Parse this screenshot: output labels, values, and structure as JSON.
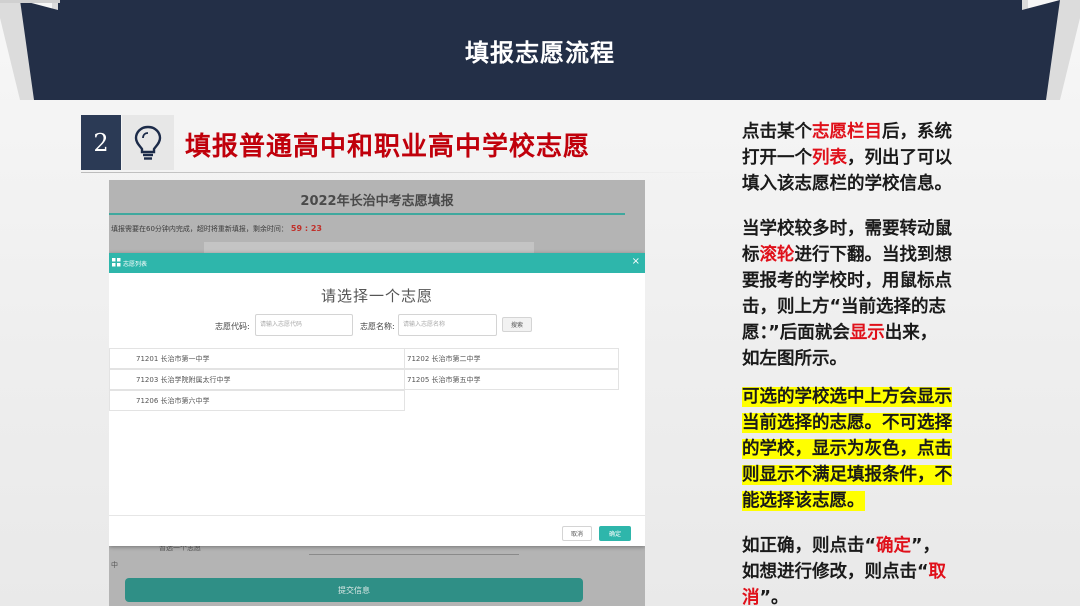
{
  "header": {
    "title": "填报志愿流程"
  },
  "section": {
    "number": "2",
    "icon": "lightbulb-icon",
    "title": "填报普通高中和职业高中学校志愿"
  },
  "screenshot": {
    "page_title": "2022年长治中考志愿填报",
    "timer_text": "填报需要在60分钟内完成，超时将重新填报，剩余时间：",
    "timer_value": "59 : 23",
    "modal": {
      "header_label": "志愿列表",
      "close_symbol": "×",
      "prompt": "请选择一个志愿",
      "code_label": "志愿代码:",
      "code_placeholder": "请输入志愿代码",
      "name_label": "志愿名称:",
      "name_placeholder": "请输入志愿名称",
      "search_label": "搜索",
      "schools": [
        "71201  长治市第一中学",
        "71202  长治市第二中学",
        "71203  长治学院附属太行中学",
        "71205  长治市第五中学",
        "71206  长治市第六中学"
      ],
      "cancel_label": "取消",
      "ok_label": "确定"
    },
    "behind_text": "暂选一个志愿",
    "behind_mark": "中",
    "submit_label": "提交信息"
  },
  "right_text": {
    "p1": {
      "l1a": "点击某个",
      "l1b": "志愿栏目",
      "l1c": "后，系统",
      "l2a": "打开一个",
      "l2b": "列表",
      "l2c": "，列出了可以",
      "l3": "填入该志愿栏的学校信息。"
    },
    "p2": {
      "l1": "当学校较多时，需要转动鼠",
      "l2a": "标",
      "l2b": "滚轮",
      "l2c": "进行下翻。当找到想",
      "l3": "要报考的学校时，用鼠标点",
      "l4": "击，则上方“当前选择的志",
      "l5a": "愿：”后面就会",
      "l5b": "显示",
      "l5c": "出来，",
      "l6": "如左图所示。"
    },
    "p3": {
      "l1": "可选的学校选中上方会显示",
      "l2": "当前选择的志愿。不可选择",
      "l3": "的学校，显示为灰色，点击",
      "l4": "则显示不满足填报条件，不",
      "l5": "能选择该志愿。"
    },
    "p4": {
      "l1a": "如正确，则点击“",
      "l1b": "确定",
      "l1c": "”，",
      "l2a": "如想进行修改，则点击“",
      "l2b": "取",
      "l3a": "消",
      "l3b": "”。"
    }
  },
  "colors": {
    "banner": "#232f47",
    "accent_red": "#c0000b",
    "teal": "#2eb6ab",
    "highlight": "#ffff00"
  }
}
